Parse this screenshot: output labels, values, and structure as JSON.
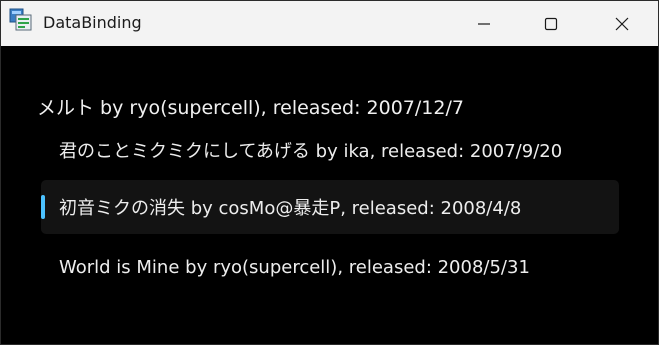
{
  "window": {
    "title": "DataBinding"
  },
  "content": {
    "heading": "メルト by ryo(supercell), released: 2007/12/7",
    "items": [
      {
        "label": "君のことミクミクにしてあげる by ika, released: 2007/9/20",
        "selected": false
      },
      {
        "label": "初音ミクの消失 by cosMo@暴走P, released: 2008/4/8",
        "selected": true
      },
      {
        "label": "World is Mine by ryo(supercell), released: 2008/5/31",
        "selected": false
      }
    ]
  },
  "colors": {
    "titlebar_bg": "#f3f3f3",
    "content_bg": "#000000",
    "selection_bg": "#131313",
    "selection_accent": "#4cc2ff",
    "text": "#ededed"
  },
  "icons": {
    "app": "app-icon",
    "minimize": "minimize-icon",
    "maximize": "maximize-icon",
    "close": "close-icon"
  }
}
